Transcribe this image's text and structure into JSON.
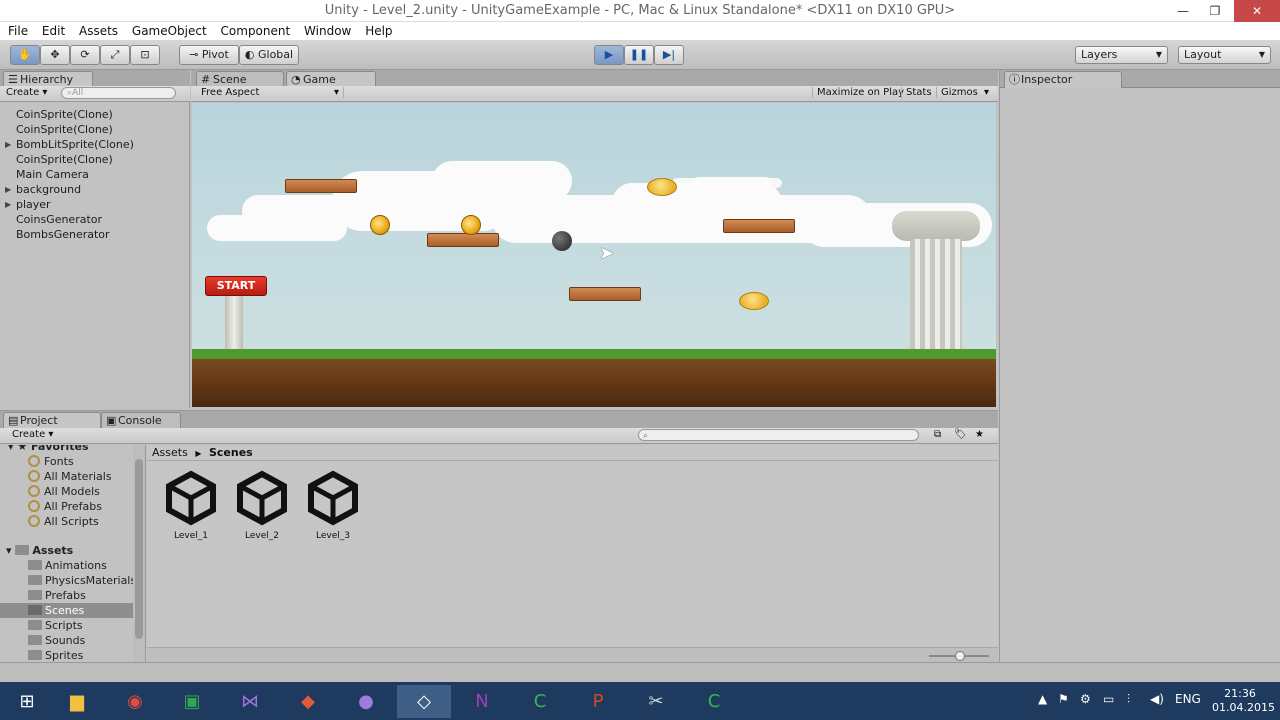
{
  "window": {
    "title": "Unity - Level_2.unity - UnityGameExample - PC, Mac & Linux Standalone* <DX11 on DX10 GPU>",
    "min": "—",
    "max": "❐",
    "close": "✕"
  },
  "menu": [
    "File",
    "Edit",
    "Assets",
    "GameObject",
    "Component",
    "Window",
    "Help"
  ],
  "toolbar": {
    "tools": [
      "hand-tool",
      "move-tool",
      "rotate-tool",
      "scale-tool",
      "rect-tool"
    ],
    "pivot": "Pivot",
    "global": "Global",
    "layers": "Layers",
    "layout": "Layout"
  },
  "hierarchy": {
    "tab": "Hierarchy",
    "create": "Create",
    "search_placeholder": "All",
    "items": [
      {
        "label": "CoinSprite(Clone)",
        "expandable": false
      },
      {
        "label": "CoinSprite(Clone)",
        "expandable": false
      },
      {
        "label": "BombLitSprite(Clone)",
        "expandable": true
      },
      {
        "label": "CoinSprite(Clone)",
        "expandable": false
      },
      {
        "label": "Main Camera",
        "expandable": false
      },
      {
        "label": "background",
        "expandable": true
      },
      {
        "label": "player",
        "expandable": true
      },
      {
        "label": "CoinsGenerator",
        "expandable": false
      },
      {
        "label": "BombsGenerator",
        "expandable": false
      }
    ]
  },
  "scene_tabs": {
    "scene": "Scene",
    "game": "Game"
  },
  "game_bar": {
    "aspect": "Free Aspect",
    "maximize": "Maximize on Play",
    "stats": "Stats",
    "gizmos": "Gizmos"
  },
  "game_view": {
    "start_label": "START"
  },
  "inspector": {
    "tab": "Inspector"
  },
  "project": {
    "tab": "Project",
    "console_tab": "Console",
    "create": "Create",
    "favorites_label": "Favorites",
    "favorites": [
      "Fonts",
      "All Materials",
      "All Models",
      "All Prefabs",
      "All Scripts"
    ],
    "assets_label": "Assets",
    "assets": [
      "Animations",
      "PhysicsMaterials",
      "Prefabs",
      "Scenes",
      "Scripts",
      "Sounds",
      "Sprites"
    ],
    "selected_folder": "Scenes",
    "breadcrumb": [
      "Assets",
      "Scenes"
    ],
    "files": [
      "Level_1",
      "Level_2",
      "Level_3"
    ]
  },
  "taskbar": {
    "lang": "ENG",
    "time": "21:36",
    "date": "01.04.2015"
  },
  "colors": {
    "title_close": "#c74848",
    "play_active": "#7a98c4",
    "taskbar": "#1f3a5f"
  }
}
